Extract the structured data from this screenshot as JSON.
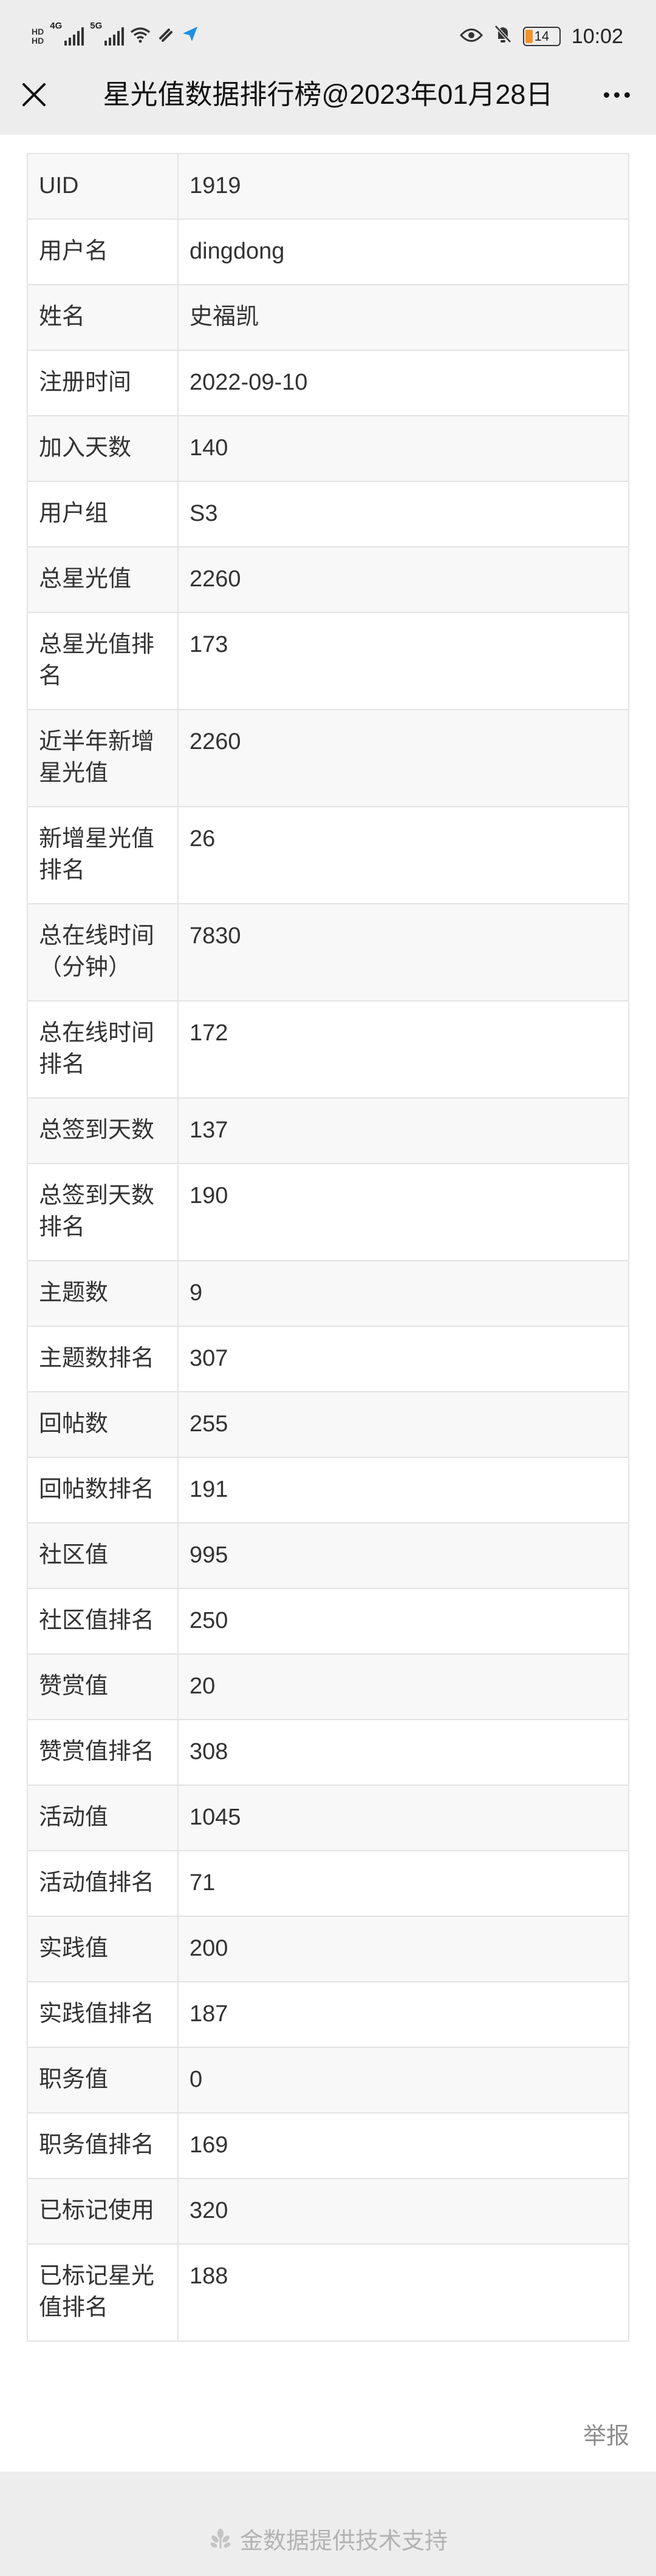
{
  "status_bar": {
    "left_tag_1": "HD",
    "left_tag_2": "4G",
    "left_tag_3": "5G",
    "battery": "14",
    "time": "10:02"
  },
  "header": {
    "title": "星光值数据排行榜@2023年01月28日"
  },
  "rows": [
    {
      "label": "UID",
      "value": "1919"
    },
    {
      "label": "用户名",
      "value": "dingdong"
    },
    {
      "label": "姓名",
      "value": "史福凯"
    },
    {
      "label": "注册时间",
      "value": "2022-09-10"
    },
    {
      "label": "加入天数",
      "value": "140"
    },
    {
      "label": "用户组",
      "value": "S3"
    },
    {
      "label": "总星光值",
      "value": "2260"
    },
    {
      "label": "总星光值排名",
      "value": "173"
    },
    {
      "label": "近半年新增星光值",
      "value": "2260"
    },
    {
      "label": "新增星光值排名",
      "value": "26"
    },
    {
      "label": "总在线时间（分钟）",
      "value": "7830"
    },
    {
      "label": "总在线时间排名",
      "value": "172"
    },
    {
      "label": "总签到天数",
      "value": "137"
    },
    {
      "label": "总签到天数排名",
      "value": "190"
    },
    {
      "label": "主题数",
      "value": "9"
    },
    {
      "label": "主题数排名",
      "value": "307"
    },
    {
      "label": "回帖数",
      "value": "255"
    },
    {
      "label": "回帖数排名",
      "value": "191"
    },
    {
      "label": "社区值",
      "value": "995"
    },
    {
      "label": "社区值排名",
      "value": "250"
    },
    {
      "label": "赞赏值",
      "value": "20"
    },
    {
      "label": "赞赏值排名",
      "value": "308"
    },
    {
      "label": "活动值",
      "value": "1045"
    },
    {
      "label": "活动值排名",
      "value": "71"
    },
    {
      "label": "实践值",
      "value": "200"
    },
    {
      "label": "实践值排名",
      "value": "187"
    },
    {
      "label": "职务值",
      "value": "0"
    },
    {
      "label": "职务值排名",
      "value": "169"
    },
    {
      "label": "已标记使用",
      "value": "320"
    },
    {
      "label": "已标记星光值排名",
      "value": "188"
    }
  ],
  "report_label": "举报",
  "footer_text": "金数据提供技术支持",
  "colors": {
    "page_bg": "#ededed",
    "table_border": "#e3e3e3",
    "stripe": "#f8f8f8",
    "footer_text": "#b3b3b3",
    "battery_low": "#f0932b"
  },
  "icons": [
    "signal-icon",
    "wifi-icon",
    "mute-icon",
    "navigation-icon",
    "eye-icon",
    "bell-off-icon",
    "battery-icon",
    "close-icon",
    "more-icon",
    "jinshuju-logo-icon"
  ]
}
